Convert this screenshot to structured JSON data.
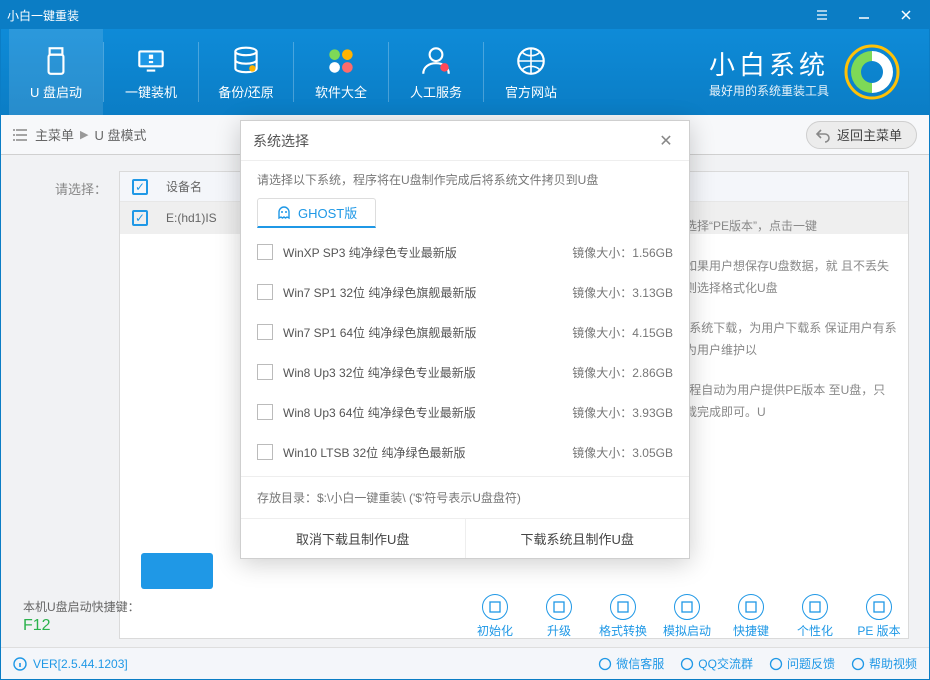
{
  "titlebar": {
    "title": "小白一键重装"
  },
  "nav": {
    "items": [
      {
        "id": "u-boot",
        "label": "U 盘启动",
        "icon": "usb"
      },
      {
        "id": "onekey",
        "label": "一键装机",
        "icon": "monitor"
      },
      {
        "id": "backup",
        "label": "备份/还原",
        "icon": "disks"
      },
      {
        "id": "software",
        "label": "软件大全",
        "icon": "apps"
      },
      {
        "id": "service",
        "label": "人工服务",
        "icon": "person"
      },
      {
        "id": "website",
        "label": "官方网站",
        "icon": "globe"
      }
    ],
    "active": "u-boot"
  },
  "brand": {
    "title": "小白系统",
    "sub": "最好用的系统重装工具"
  },
  "breadcrumb": {
    "root": "主菜单",
    "current": "U 盘模式",
    "back": "返回主菜单"
  },
  "content": {
    "left_label": "请选择：",
    "table_header": "设备名",
    "device_row": "E:(hd1)IS",
    "desc1": "，右下角选择“PE版本”，点击一键",
    "desc2": "化方式，如果用户想保存U盘数据，就 且不丢失数据，否则选择格式化U盘",
    "desc3": "重装\"提供系统下载，为用户下载系 保证用户有系统可装，为用户维护以",
    "desc4": "重装\"将全程自动为用户提供PE版本 至U盘，只需等待下载完成即可。U"
  },
  "actions": [
    {
      "id": "init",
      "label": "初始化"
    },
    {
      "id": "upgrade",
      "label": "升级"
    },
    {
      "id": "format",
      "label": "格式转换"
    },
    {
      "id": "simulate",
      "label": "模拟启动"
    },
    {
      "id": "hotkey",
      "label": "快捷键"
    },
    {
      "id": "personal",
      "label": "个性化"
    },
    {
      "id": "pe",
      "label": "PE 版本"
    }
  ],
  "hotkey": {
    "label": "本机U盘启动快捷键：",
    "value": "F12"
  },
  "statusbar": {
    "version": "VER[2.5.44.1203]",
    "links": [
      {
        "id": "wechat",
        "label": "微信客服"
      },
      {
        "id": "qq",
        "label": "QQ交流群"
      },
      {
        "id": "feedback",
        "label": "问题反馈"
      },
      {
        "id": "help",
        "label": "帮助视频"
      }
    ]
  },
  "modal": {
    "title": "系统选择",
    "info": "请选择以下系统，程序将在U盘制作完成后将系统文件拷贝到U盘",
    "tab": "GHOST版",
    "note": "存放目录：$:\\小白一键重装\\ ('$'符号表示U盘盘符)",
    "cancel": "取消下载且制作U盘",
    "confirm": "下载系统且制作U盘",
    "size_prefix": "镜像大小：",
    "systems": [
      {
        "name": "WinXP SP3 纯净绿色专业最新版",
        "size": "1.56GB"
      },
      {
        "name": "Win7 SP1 32位 纯净绿色旗舰最新版",
        "size": "3.13GB"
      },
      {
        "name": "Win7 SP1 64位 纯净绿色旗舰最新版",
        "size": "4.15GB"
      },
      {
        "name": "Win8 Up3 32位 纯净绿色专业最新版",
        "size": "2.86GB"
      },
      {
        "name": "Win8 Up3 64位 纯净绿色专业最新版",
        "size": "3.93GB"
      },
      {
        "name": "Win10 LTSB 32位 纯净绿色最新版",
        "size": "3.05GB"
      }
    ]
  }
}
